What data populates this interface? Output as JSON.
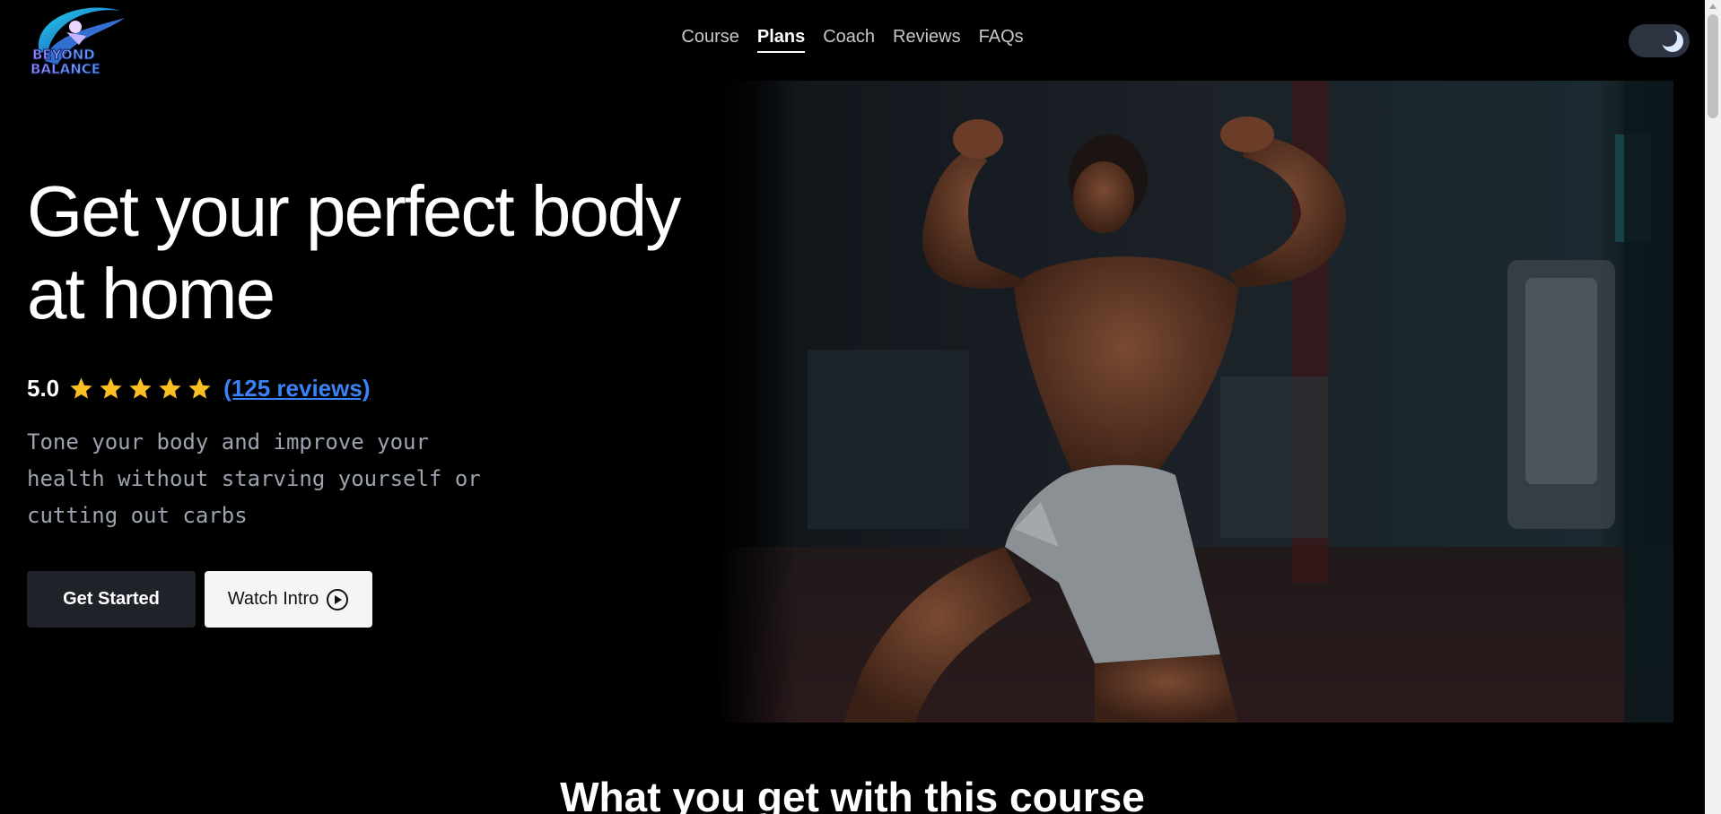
{
  "brand": {
    "logo_text_line1": "BEYOND",
    "logo_text_line2": "BALANCE"
  },
  "nav": {
    "items": [
      {
        "label": "Course"
      },
      {
        "label": "Plans"
      },
      {
        "label": "Coach"
      },
      {
        "label": "Reviews"
      },
      {
        "label": "FAQs"
      }
    ],
    "active": "Plans"
  },
  "theme_toggle": {
    "icon": "moon-icon",
    "state": "dark"
  },
  "hero": {
    "title_line1": "Get your perfect body",
    "title_line2": "at home",
    "rating_value": "5.0",
    "stars": 5,
    "reviews_link": "(125 reviews)",
    "tagline": "Tone your body and improve your health without starving yourself or cutting out carbs",
    "primary_button": "Get Started",
    "secondary_button": "Watch Intro",
    "image_description_icon": "hero-photo"
  },
  "section": {
    "title": "What you get with this course"
  },
  "colors": {
    "accent_link": "#3b82f6",
    "star": "#fbbf24",
    "background": "#000000"
  }
}
